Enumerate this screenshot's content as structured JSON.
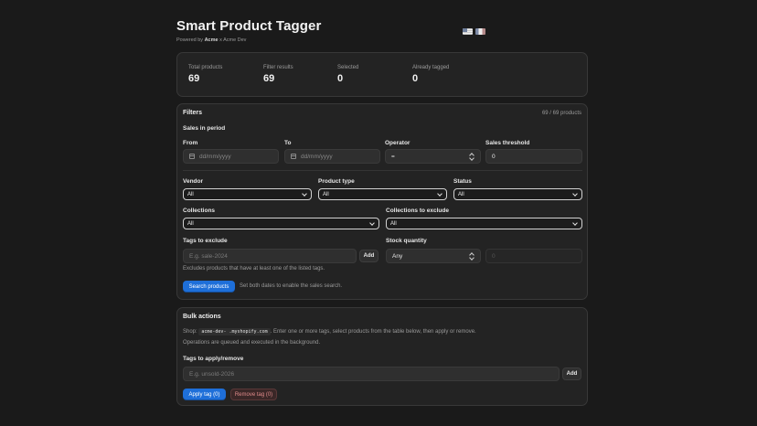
{
  "header": {
    "title": "Smart Product Tagger",
    "powered_prefix": "Powered by",
    "powered_brand": "Acme",
    "powered_suffix": "x Acme Dev",
    "lang_us_icon": "flag-us-icon",
    "lang_fr_icon": "flag-fr-icon"
  },
  "stats": [
    {
      "label": "Total products",
      "value": "69"
    },
    {
      "label": "Filter results",
      "value": "69"
    },
    {
      "label": "Selected",
      "value": "0"
    },
    {
      "label": "Already tagged",
      "value": "0"
    }
  ],
  "filters": {
    "title": "Filters",
    "count": "69 / 69 products",
    "sales_period": "Sales in period",
    "from_label": "From",
    "from_placeholder": "dd/mm/yyyy",
    "to_label": "To",
    "to_placeholder": "dd/mm/yyyy",
    "operator_label": "Operator",
    "operator_value": "=",
    "threshold_label": "Sales threshold",
    "threshold_value": "0",
    "vendor_label": "Vendor",
    "vendor_value": "All",
    "product_type_label": "Product type",
    "product_type_value": "All",
    "status_label": "Status",
    "status_value": "All",
    "collections_label": "Collections",
    "collections_value": "All",
    "collections_exclude_label": "Collections to exclude",
    "collections_exclude_value": "All",
    "tags_exclude_label": "Tags to exclude",
    "tags_exclude_placeholder": "E.g. sale-2024",
    "add_label": "Add",
    "tags_exclude_help": "Excludes products that have at least one of the listed tags.",
    "stock_label": "Stock quantity",
    "stock_value": "Any",
    "stock_number_placeholder": "0",
    "search_button": "Search products",
    "search_hint": "Set both dates to enable the sales search."
  },
  "bulk": {
    "title": "Bulk actions",
    "shop_prefix": "Shop:",
    "shop_code": "acme-dev-      .myshopify.com",
    "shop_text": ". Enter one or more tags, select products from the table below, then apply or remove.",
    "queue_text": "Operations are queued and executed in the background.",
    "tags_label": "Tags to apply/remove",
    "tags_placeholder": "E.g. unsold-2026",
    "add_label": "Add",
    "apply_button": "Apply tag (0)",
    "remove_button": "Remove tag (0)"
  },
  "colors": {
    "background": "#1a1a1a",
    "card": "#232323",
    "primary": "#1e6fd9",
    "danger_text": "#e08b8b"
  }
}
